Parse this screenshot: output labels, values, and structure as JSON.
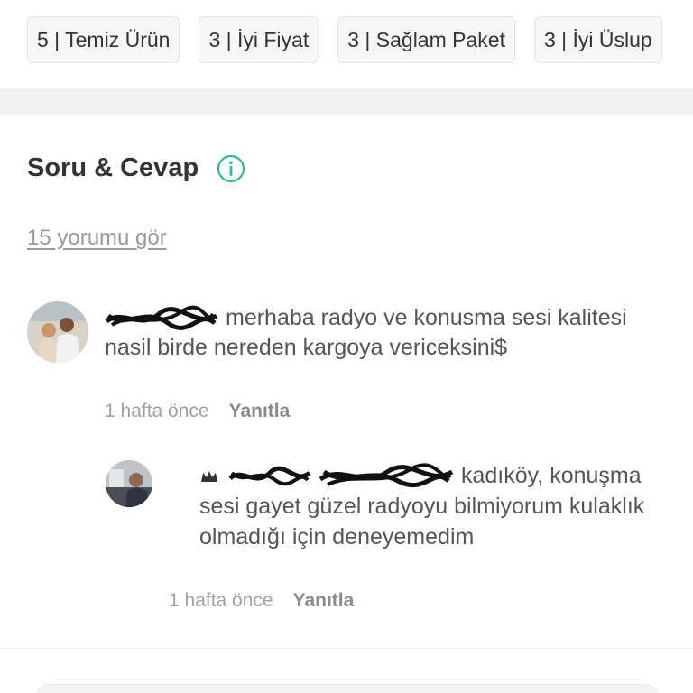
{
  "chips": [
    {
      "label": "5 | Temiz Ürün"
    },
    {
      "label": "3 | İyi Fiyat"
    },
    {
      "label": "3 | Sağlam Paket"
    },
    {
      "label": "3 | İyi Üslup"
    }
  ],
  "section": {
    "title": "Soru & Cevap",
    "info_icon": "info-circle-icon",
    "accent": "#2bbf8a",
    "see_all": "15 yorumu gör"
  },
  "comments": [
    {
      "text": "merhaba radyo ve konusma sesi kalitesi nasil birde nereden kargoya vericeksini$",
      "time": "1 hafta önce",
      "reply": "Yanıtla"
    },
    {
      "text": "kadıköy, konuşma sesi gayet güzel radyoyu bilmiyorum kulaklık olmadığı için deneyemedim",
      "time": "1 hafta önce",
      "reply": "Yanıtla",
      "badge_icon": "crown-icon"
    }
  ]
}
